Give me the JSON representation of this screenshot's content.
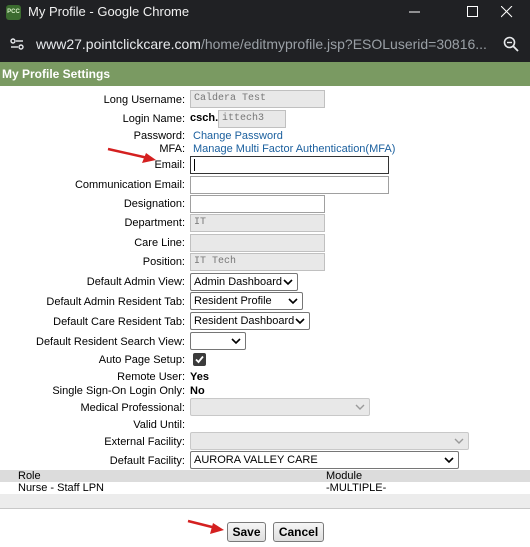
{
  "window": {
    "title": "My Profile - Google Chrome",
    "favicon_text": "PCC",
    "url_host": "www27.pointclickcare.com",
    "url_path": "/home/editmyprofile.jsp?ESOLuserid=30816..."
  },
  "section": {
    "title": "My Profile Settings"
  },
  "form": {
    "long_username": {
      "label": "Long Username:",
      "value": "Caldera Test"
    },
    "login_name": {
      "label": "Login Name:",
      "prefix": "csch.",
      "value": "ittech3"
    },
    "password": {
      "label": "Password:",
      "link": "Change Password"
    },
    "mfa": {
      "label": "MFA:",
      "link": "Manage Multi Factor Authentication(MFA)"
    },
    "email": {
      "label": "Email:",
      "value": ""
    },
    "communication_email": {
      "label": "Communication Email:",
      "value": ""
    },
    "designation": {
      "label": "Designation:",
      "value": ""
    },
    "department": {
      "label": "Department:",
      "value": "IT"
    },
    "care_line": {
      "label": "Care Line:",
      "value": ""
    },
    "position": {
      "label": "Position:",
      "value": "IT Tech"
    },
    "default_admin_view": {
      "label": "Default Admin View:",
      "selected": "Admin Dashboard"
    },
    "default_admin_resident_tab": {
      "label": "Default Admin Resident Tab:",
      "selected": "Resident Profile"
    },
    "default_care_resident_tab": {
      "label": "Default Care Resident Tab:",
      "selected": "Resident Dashboard"
    },
    "default_resident_search_view": {
      "label": "Default Resident Search View:",
      "selected": ""
    },
    "auto_page_setup": {
      "label": "Auto Page Setup:",
      "checked": true
    },
    "remote_user": {
      "label": "Remote User:",
      "value": "Yes"
    },
    "sso_login_only": {
      "label": "Single Sign-On Login Only:",
      "value": "No"
    },
    "medical_professional": {
      "label": "Medical Professional:",
      "selected": ""
    },
    "valid_until": {
      "label": "Valid Until:",
      "value": ""
    },
    "external_facility": {
      "label": "External Facility:",
      "selected": ""
    },
    "default_facility": {
      "label": "Default Facility:",
      "selected": "AURORA VALLEY CARE"
    }
  },
  "roles": {
    "headers": {
      "role": "Role",
      "module": "Module"
    },
    "rows": [
      {
        "role": "Nurse - Staff LPN",
        "module": "-MULTIPLE-"
      }
    ]
  },
  "actions": {
    "save": "Save",
    "cancel": "Cancel"
  },
  "colors": {
    "header_green": "#7a9a62",
    "link_blue": "#1a5f9e",
    "arrow_red": "#d42020"
  }
}
